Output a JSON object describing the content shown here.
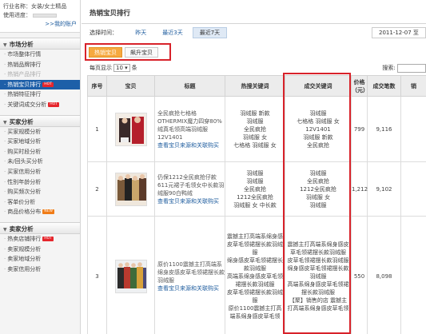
{
  "sidebar": {
    "industry": "行业名称：女装/女士精品",
    "usage": "使用进度：",
    "my_account": ">>我的账户",
    "sections": [
      {
        "title": "市场分析",
        "items": [
          {
            "label": "市场整体行情",
            "state": "normal",
            "badge": ""
          },
          {
            "label": "热销品牌排行",
            "state": "normal",
            "badge": ""
          },
          {
            "label": "热销产品排行",
            "state": "dim",
            "badge": ""
          },
          {
            "label": "热销宝贝排行",
            "state": "active",
            "badge": "HOT"
          },
          {
            "label": "热销特征排行",
            "state": "normal",
            "badge": ""
          },
          {
            "label": "关键词成交分析",
            "state": "normal",
            "badge": "HOT"
          }
        ]
      },
      {
        "title": "买家分析",
        "items": [
          {
            "label": "买家规模分析",
            "state": "normal",
            "badge": ""
          },
          {
            "label": "买家地域分析",
            "state": "normal",
            "badge": ""
          },
          {
            "label": "购买时段分析",
            "state": "normal",
            "badge": ""
          },
          {
            "label": "未/回头买分析",
            "state": "normal",
            "badge": ""
          },
          {
            "label": "买家信用分析",
            "state": "normal",
            "badge": ""
          },
          {
            "label": "性别年龄分析",
            "state": "normal",
            "badge": ""
          },
          {
            "label": "购买频次分析",
            "state": "normal",
            "badge": ""
          },
          {
            "label": "客单价分析",
            "state": "normal",
            "badge": ""
          },
          {
            "label": "商品价格分布",
            "state": "normal",
            "badge": "NEW"
          }
        ]
      },
      {
        "title": "卖家分析",
        "items": [
          {
            "label": "热卖店铺排行",
            "state": "normal",
            "badge": "HOT"
          },
          {
            "label": "卖家规模分析",
            "state": "normal",
            "badge": ""
          },
          {
            "label": "卖家地域分析",
            "state": "normal",
            "badge": ""
          },
          {
            "label": "卖家信用分析",
            "state": "normal",
            "badge": ""
          }
        ]
      }
    ]
  },
  "main": {
    "title": "热销宝贝排行",
    "time_label": "选择时间：",
    "time_options": [
      {
        "label": "昨天",
        "selected": false
      },
      {
        "label": "最近3天",
        "selected": false
      },
      {
        "label": "最近7天",
        "selected": true
      }
    ],
    "date_range": "2011-12-07 至",
    "tabs": [
      {
        "label": "热销宝贝",
        "selected": true
      },
      {
        "label": "飙升宝贝",
        "selected": false
      }
    ],
    "page_size_prefix": "每页显示",
    "page_size_value": "10",
    "page_size_suffix": "条",
    "search_label": "搜索:"
  },
  "table": {
    "headers": [
      "序号",
      "宝贝",
      "标题",
      "热搜关键词",
      "成交关键词",
      "价格（元）",
      "成交笔数",
      "销"
    ],
    "view_link": "查看宝贝来源和关联购买",
    "rows": [
      {
        "index": "1",
        "title": "全民疯抢七格格 OTHERMIX魔力四穿80%绒真毛领高端羽绒服12V1401",
        "hot_keywords": [
          "羽绒服 新款",
          "羽绒服",
          "全民疯抢",
          "羽绒服 女",
          "七格格 羽绒服 女"
        ],
        "deal_keywords": [
          "羽绒服",
          "七格格 羽绒服 女",
          "12V1401",
          "羽绒服 新款",
          "全民疯抢"
        ],
        "price": "799",
        "orders": "9,116"
      },
      {
        "index": "2",
        "title": "仍保1212全民疯抢仔款611元裙子毛领女中长款羽绒服90白鸭绒",
        "hot_keywords": [
          "羽绒服",
          "羽绒服",
          "全民疯抢",
          "1212全民疯抢",
          "羽绒服 女 中长款"
        ],
        "deal_keywords": [
          "羽绒服",
          "全民疯抢",
          "1212全民疯抢",
          "羽绒服 女",
          "羽绒服"
        ],
        "price": "1,212",
        "orders": "9,102"
      },
      {
        "index": "3",
        "title": "原价1100震撼主打高端系绵身皮感皮草毛领裙摆长款羽绒服",
        "hot_keywords": [
          "震撼主打高端系绵身感皮草毛领裙摆长款羽绒服",
          "绵身感皮草毛领裙摆长款羽绒服",
          "高端系绵身感皮草毛领裙摆长款羽绒服",
          "皮草毛领裙摆长款羽绒服",
          "原价1100震撼主打高端系绵身感皮草毛领"
        ],
        "deal_keywords": [
          "震撼主打高端系绵身感皮草毛领裙摆长款羽绒服",
          "皮草毛领裙摆长款羽绒服",
          "绵身感皮草毛领裙摆长款羽绒服",
          "高端系绵身感皮草毛领裙摆长款羽绒服",
          "【聚】销售的店 震撼主打高端系绵身感皮草毛领"
        ],
        "price": "550",
        "orders": "8,098"
      }
    ]
  }
}
